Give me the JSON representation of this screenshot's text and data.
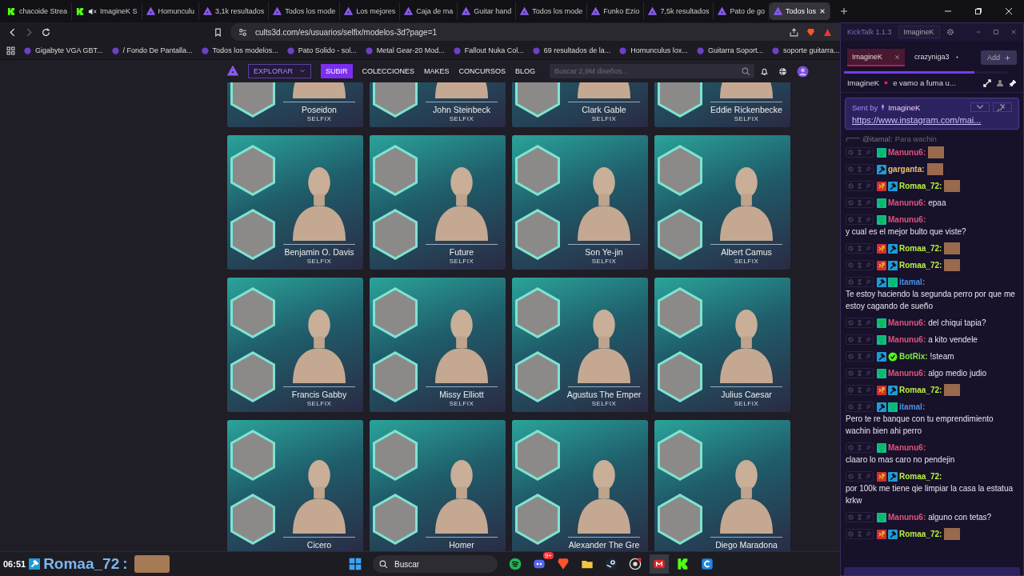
{
  "tabs": [
    {
      "label": "chacoide Strea",
      "kind": "kick",
      "muted": false,
      "selected": false
    },
    {
      "label": "ImagineK S",
      "kind": "kick",
      "muted": true,
      "selected": false
    },
    {
      "label": "Homunculu",
      "kind": "cults",
      "muted": false,
      "selected": false
    },
    {
      "label": "3,1k resultados",
      "kind": "cults",
      "muted": false,
      "selected": false
    },
    {
      "label": "Todos los mode",
      "kind": "cults",
      "muted": false,
      "selected": false
    },
    {
      "label": "Los mejores",
      "kind": "cults",
      "muted": false,
      "selected": false
    },
    {
      "label": "Caja de ma",
      "kind": "cults",
      "muted": false,
      "selected": false
    },
    {
      "label": "Guitar hand",
      "kind": "cults",
      "muted": false,
      "selected": false
    },
    {
      "label": "Todos los mode",
      "kind": "cults",
      "muted": false,
      "selected": false
    },
    {
      "label": "Funko Ezio",
      "kind": "cults",
      "muted": false,
      "selected": false
    },
    {
      "label": "7,5k resultados",
      "kind": "cults",
      "muted": false,
      "selected": false
    },
    {
      "label": "Pato de go",
      "kind": "cults",
      "muted": false,
      "selected": false
    },
    {
      "label": "Todos los",
      "kind": "cults",
      "muted": false,
      "selected": true
    }
  ],
  "address": "cults3d.com/es/usuarios/selfix/modelos-3d?page=1",
  "bookmarks": [
    "Gigabyte VGA GBT...",
    "/ Fondo De Pantalla...",
    "Todos los modelos...",
    "Pato Solido - sol...",
    "Metal Gear-20 Mod...",
    "Fallout Nuka Col...",
    "69 resultados de la...",
    "Homunculus lox...",
    "Guitarra Soport...",
    "soporte guitarra..."
  ],
  "site_nav": {
    "explore": "EXPLORAR",
    "upload": "SUBIR",
    "links": [
      "COLECCIONES",
      "MAKES",
      "CONCURSOS",
      "BLOG"
    ],
    "search_placeholder": "Buscar 2,9M diseños..."
  },
  "cards": [
    {
      "name": "Poseidon",
      "brand": "SELFIX"
    },
    {
      "name": "John Steinbeck",
      "brand": "SELFIX"
    },
    {
      "name": "Clark Gable",
      "brand": "SELFIX"
    },
    {
      "name": "Eddie Rickenbecke",
      "brand": "SELFIX"
    },
    {
      "name": "Benjamin O. Davis",
      "brand": "SELFIX"
    },
    {
      "name": "Future",
      "brand": "SELFIX"
    },
    {
      "name": "Son Ye-jin",
      "brand": "SELFIX"
    },
    {
      "name": "Albert Camus",
      "brand": "SELFIX"
    },
    {
      "name": "Francis Gabby",
      "brand": "SELFIX"
    },
    {
      "name": "Missy Elliott",
      "brand": "SELFIX"
    },
    {
      "name": "Agustus The Emper",
      "brand": "SELFIX"
    },
    {
      "name": "Julius Caesar",
      "brand": "SELFIX"
    },
    {
      "name": "Cicero"
    },
    {
      "name": "Homer"
    },
    {
      "name": "Alexander The Gre"
    },
    {
      "name": "Diego Maradona"
    }
  ],
  "chat": {
    "title": "KickTalk 1.1.3",
    "account": "ImagineK",
    "channels": [
      {
        "label": "ImagineK",
        "selected": true
      },
      {
        "label": "crazyniga3",
        "selected": false
      }
    ],
    "add_label": "Add",
    "progress": {
      "level": 0.8
    },
    "stream_user": "ImagineK",
    "stream_title": "e vamo a fuma u...",
    "pinned": {
      "sent_by": "Sent by",
      "user": "ImagineK",
      "link": "https://www.instagram.com/mai..."
    },
    "reply": {
      "user": "@itamal:",
      "text": "Para wachin"
    },
    "messages": [
      {
        "user": "Manunu6:",
        "color": "#e0527a",
        "badges": [
          {
            "kind": "og"
          }
        ],
        "emote": true
      },
      {
        "user": "garganta:",
        "color": "#f0c070",
        "badges": [
          {
            "kind": "mod"
          }
        ],
        "emote": true
      },
      {
        "user": "Romaa_72:",
        "color": "#b8f040",
        "badges": [
          {
            "kind": "sub"
          },
          {
            "kind": "mod"
          }
        ],
        "emote": true
      },
      {
        "user": "Manunu6:",
        "color": "#e0527a",
        "badges": [
          {
            "kind": "og"
          }
        ],
        "text": "epaa",
        "emote": false
      },
      {
        "user": "Manunu6:",
        "color": "#e0527a",
        "badges": [
          {
            "kind": "og"
          }
        ],
        "text": "y cual es el mejor bulto que viste?",
        "emote": false
      },
      {
        "user": "Romaa_72:",
        "color": "#b8f040",
        "badges": [
          {
            "kind": "sub"
          },
          {
            "kind": "mod"
          }
        ],
        "emote": true
      },
      {
        "user": "Romaa_72:",
        "color": "#b8f040",
        "badges": [
          {
            "kind": "sub"
          },
          {
            "kind": "mod"
          }
        ],
        "emote": true
      },
      {
        "user": "itamal:",
        "color": "#4a90e2",
        "badges": [
          {
            "kind": "mod"
          },
          {
            "kind": "og"
          }
        ],
        "text": "Te estoy haciendo la segunda perro por que me estoy cagando de sueño",
        "emote": false
      },
      {
        "user": "Manunu6:",
        "color": "#e0527a",
        "badges": [
          {
            "kind": "og"
          }
        ],
        "text": "del chiqui tapia?",
        "emote": false
      },
      {
        "user": "Manunu6:",
        "color": "#e0527a",
        "badges": [
          {
            "kind": "og"
          }
        ],
        "text": "a kito vendele",
        "emote": false
      },
      {
        "user": "BotRix:",
        "color": "#7cf03c",
        "badges": [
          {
            "kind": "mod"
          },
          {
            "kind": "verified"
          }
        ],
        "text": "!steam",
        "emote": false
      },
      {
        "user": "Manunu6:",
        "color": "#e0527a",
        "badges": [
          {
            "kind": "og"
          }
        ],
        "text": "algo medio judio",
        "emote": false
      },
      {
        "user": "Romaa_72:",
        "color": "#b8f040",
        "badges": [
          {
            "kind": "sub"
          },
          {
            "kind": "mod"
          }
        ],
        "emote": true
      },
      {
        "user": "itamal:",
        "color": "#4a90e2",
        "badges": [
          {
            "kind": "mod"
          },
          {
            "kind": "og"
          }
        ],
        "text": "Pero te re banque con tu emprendimiento wachin bien ahi perro",
        "emote": false
      },
      {
        "user": "Manunu6:",
        "color": "#e0527a",
        "badges": [
          {
            "kind": "og"
          }
        ],
        "text": "claaro lo mas caro no pendejin",
        "emote": false
      },
      {
        "user": "Romaa_72:",
        "color": "#b8f040",
        "badges": [
          {
            "kind": "sub"
          },
          {
            "kind": "mod"
          }
        ],
        "text": "por 100k me tiene qie limpiar la casa la estatua krkw",
        "emote": false
      },
      {
        "user": "Manunu6:",
        "color": "#e0527a",
        "badges": [
          {
            "kind": "og"
          }
        ],
        "text": "alguno con tetas?",
        "emote": false
      },
      {
        "user": "Romaa_72:",
        "color": "#b8f040",
        "badges": [
          {
            "kind": "sub"
          },
          {
            "kind": "mod"
          }
        ],
        "emote": true
      }
    ]
  },
  "overlay": {
    "time": "06:51",
    "user": "Romaa_72",
    "separator": ":"
  },
  "taskbar": {
    "search": "Buscar",
    "discord_badge": "9+"
  }
}
